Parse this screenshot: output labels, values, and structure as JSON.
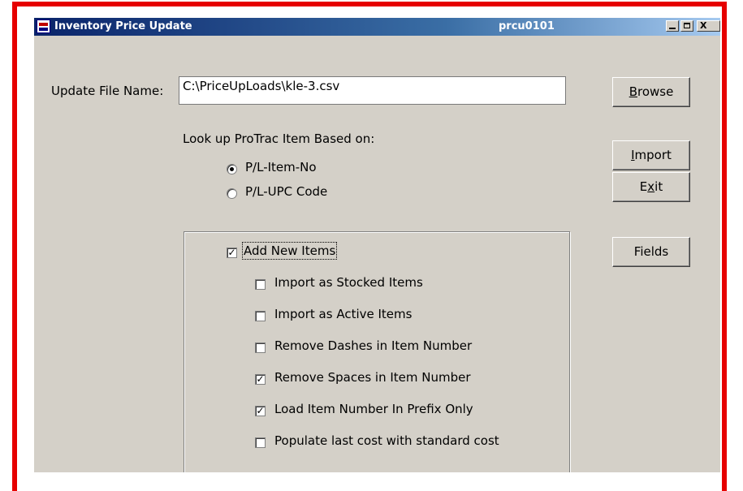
{
  "window": {
    "title": "Inventory Price Update",
    "program_code": "prcu0101",
    "close_glyph": "X",
    "titlebar_color": "#0a246a",
    "frame_color": "#e60000"
  },
  "form": {
    "file_label": "Update File Name:",
    "file_value": "C:\\PriceUpLoads\\kle-3.csv",
    "lookup_label": "Look up ProTrac Item Based on:",
    "radios": [
      {
        "label": "P/L-Item-No",
        "checked": true
      },
      {
        "label": "P/L-UPC Code",
        "checked": false
      }
    ]
  },
  "buttons": {
    "browse_prefix": "",
    "browse_key": "B",
    "browse_rest": "rowse",
    "import_prefix": "",
    "import_key": "I",
    "import_rest": "mport",
    "exit_prefix": "E",
    "exit_key": "x",
    "exit_rest": "it",
    "fields": "Fields"
  },
  "options": {
    "add_new_items": {
      "label": "Add New Items",
      "checked": true
    },
    "items": [
      {
        "label": "Import as Stocked Items",
        "checked": false
      },
      {
        "label": "Import as Active Items",
        "checked": false
      },
      {
        "label": "Remove Dashes in Item Number",
        "checked": false
      },
      {
        "label": "Remove Spaces in Item Number",
        "checked": true
      },
      {
        "label": "Load Item Number In Prefix Only",
        "checked": true
      },
      {
        "label": "Populate last cost with standard cost",
        "checked": false
      }
    ]
  }
}
